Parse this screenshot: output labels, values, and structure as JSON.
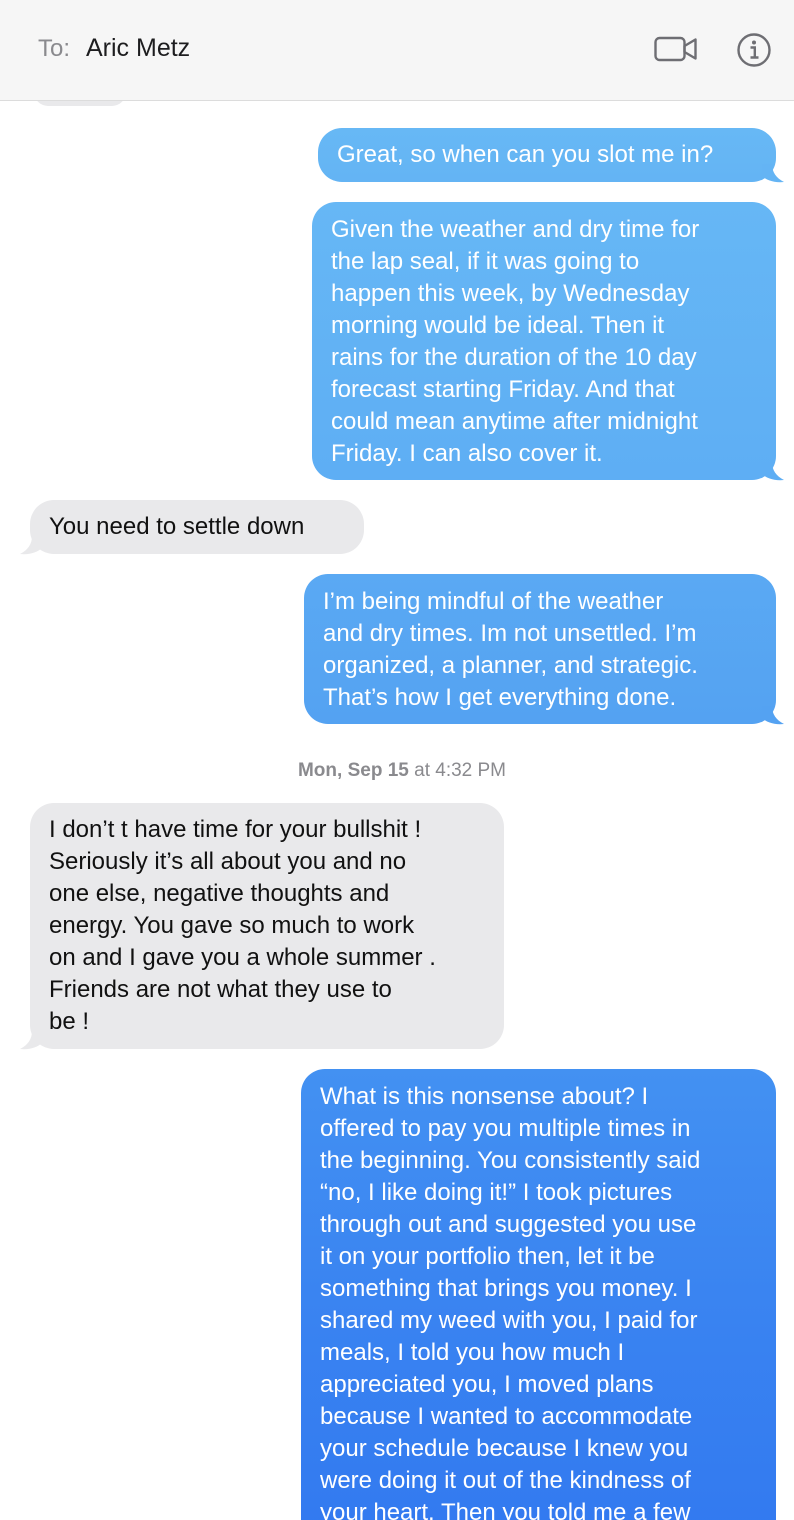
{
  "header": {
    "to_label": "To:",
    "contact_name": "Aric Metz",
    "icons": [
      "video-camera-icon",
      "info-icon"
    ]
  },
  "colors": {
    "sent_light": "#64b4f4",
    "sent_dark": "#3178f0",
    "received": "#e9e9eb",
    "header_bg": "#f6f6f6"
  },
  "messages": [
    {
      "direction": "sent",
      "text": "Great, so when can you slot me in?"
    },
    {
      "direction": "sent",
      "text": "Given the weather and dry time for\nthe lap seal, if it was going to\nhappen this week, by Wednesday\nmorning would be ideal. Then it\nrains for the duration of the 10 day\nforecast starting Friday. And that\ncould mean anytime after midnight\nFriday. I can also cover it."
    },
    {
      "direction": "received",
      "text": "You need to settle down"
    },
    {
      "direction": "sent",
      "text": "I’m being mindful of the weather\nand dry times. Im not unsettled. I’m\norganized, a planner, and strategic.\nThat’s how I get everything done."
    },
    {
      "direction": "received",
      "text": "I don’t t have time for your bullshit !\nSeriously it’s all about you and no\none else, negative thoughts and\nenergy. You gave so much to work\non and I gave you a whole summer .\nFriends are not what they use to\nbe !"
    },
    {
      "direction": "sent",
      "text": "What is this nonsense about? I\noffered to pay you multiple times in\nthe beginning. You consistently said\n“no, I like doing it!” I took pictures\nthrough out and suggested you use\nit on your portfolio then, let it be\nsomething that brings you money. I\nshared my weed with you, I paid for\nmeals, I told you how much I\nappreciated you, I moved plans\nbecause I wanted to accommodate\nyour schedule because I knew you\nwere doing it out of the kindness of\nyour heart. Then you told me a few"
    }
  ],
  "timestamp": {
    "day": "Mon, Sep 15",
    "time": " at 4:32 PM"
  }
}
